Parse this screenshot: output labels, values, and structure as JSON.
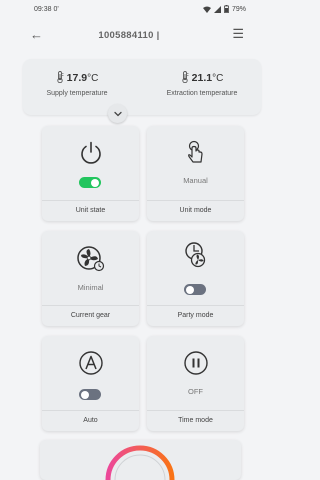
{
  "status": {
    "time": "09:38",
    "extra": "0'",
    "battery": "79%"
  },
  "header": {
    "back_icon": "arrow-left-icon",
    "title": "1005884110 |",
    "menu_icon": "hamburger-menu-icon"
  },
  "temperatures": {
    "supply": {
      "value": "17.9",
      "unit": "°C",
      "label": "Supply temperature",
      "icon": "thermometer-icon"
    },
    "extraction": {
      "value": "21.1",
      "unit": "°C",
      "label": "Extraction temperature",
      "icon": "thermometer-icon"
    }
  },
  "tiles": {
    "unit_state": {
      "label": "Unit state",
      "icon": "power-icon",
      "toggle_on": true
    },
    "unit_mode": {
      "label": "Unit mode",
      "icon": "hand-pointer-icon",
      "value": "Manual"
    },
    "current_gear": {
      "label": "Current gear",
      "icon": "fan-icon",
      "value": "Minimal"
    },
    "party_mode": {
      "label": "Party mode",
      "icon": "fan-timer-icon",
      "toggle_on": false
    },
    "auto": {
      "label": "Auto",
      "icon": "circle-a-icon",
      "toggle_on": false
    },
    "time_mode": {
      "label": "Time mode",
      "icon": "pause-circle-icon",
      "value": "OFF"
    }
  },
  "colors": {
    "toggle_on": "#22c55e",
    "toggle_off": "#6b7280",
    "gear_ring_start": "#f97316",
    "gear_ring_end": "#ec4899"
  }
}
